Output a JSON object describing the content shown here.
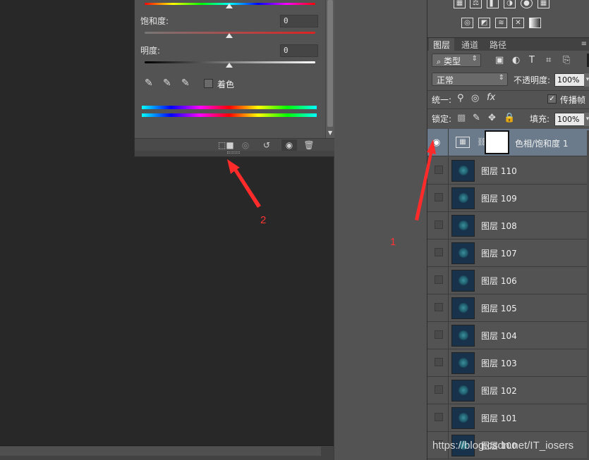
{
  "properties": {
    "saturation_label": "饱和度:",
    "saturation_value": "0",
    "lightness_label": "明度:",
    "lightness_value": "0",
    "colorize_label": "着色",
    "footer_icons": [
      "clip-to-layer-icon",
      "view-previous-icon",
      "reset-icon",
      "visibility-icon",
      "delete-icon"
    ]
  },
  "adjustments_icons": [
    "brightness-icon",
    "levels-icon",
    "curves-icon",
    "exposure-icon",
    "vibrance-icon",
    "hue-sat-icon",
    "color-balance-icon",
    "bw-icon",
    "photo-filter-icon",
    "channel-mixer-icon",
    "color-lookup-icon",
    "invert-icon",
    "posterize-icon",
    "threshold-icon",
    "gradient-map-icon"
  ],
  "layers_panel": {
    "tabs": [
      "图层",
      "通道",
      "路径"
    ],
    "filter_label": "类型",
    "blend_mode": "正常",
    "opacity_label": "不透明度:",
    "opacity_value": "100%",
    "unify_label": "统一:",
    "propagate_label": "传播帧",
    "lock_label": "锁定:",
    "fill_label": "填充:",
    "fill_value": "100%",
    "adjustment_layer_name": "色相/饱和度 1",
    "layers": [
      "图层 110",
      "图层 109",
      "图层 108",
      "图层 107",
      "图层 106",
      "图层 105",
      "图层 104",
      "图层 103",
      "图层 102",
      "图层 101",
      "图层 100"
    ]
  },
  "annotations": {
    "label_1": "1",
    "label_2": "2"
  },
  "watermark": "https://blog.csdn.net/IT_iosers",
  "colors": {
    "annotation": "#ff3333",
    "selected_layer": "#6b7b8c",
    "panel_bg": "#535353"
  }
}
